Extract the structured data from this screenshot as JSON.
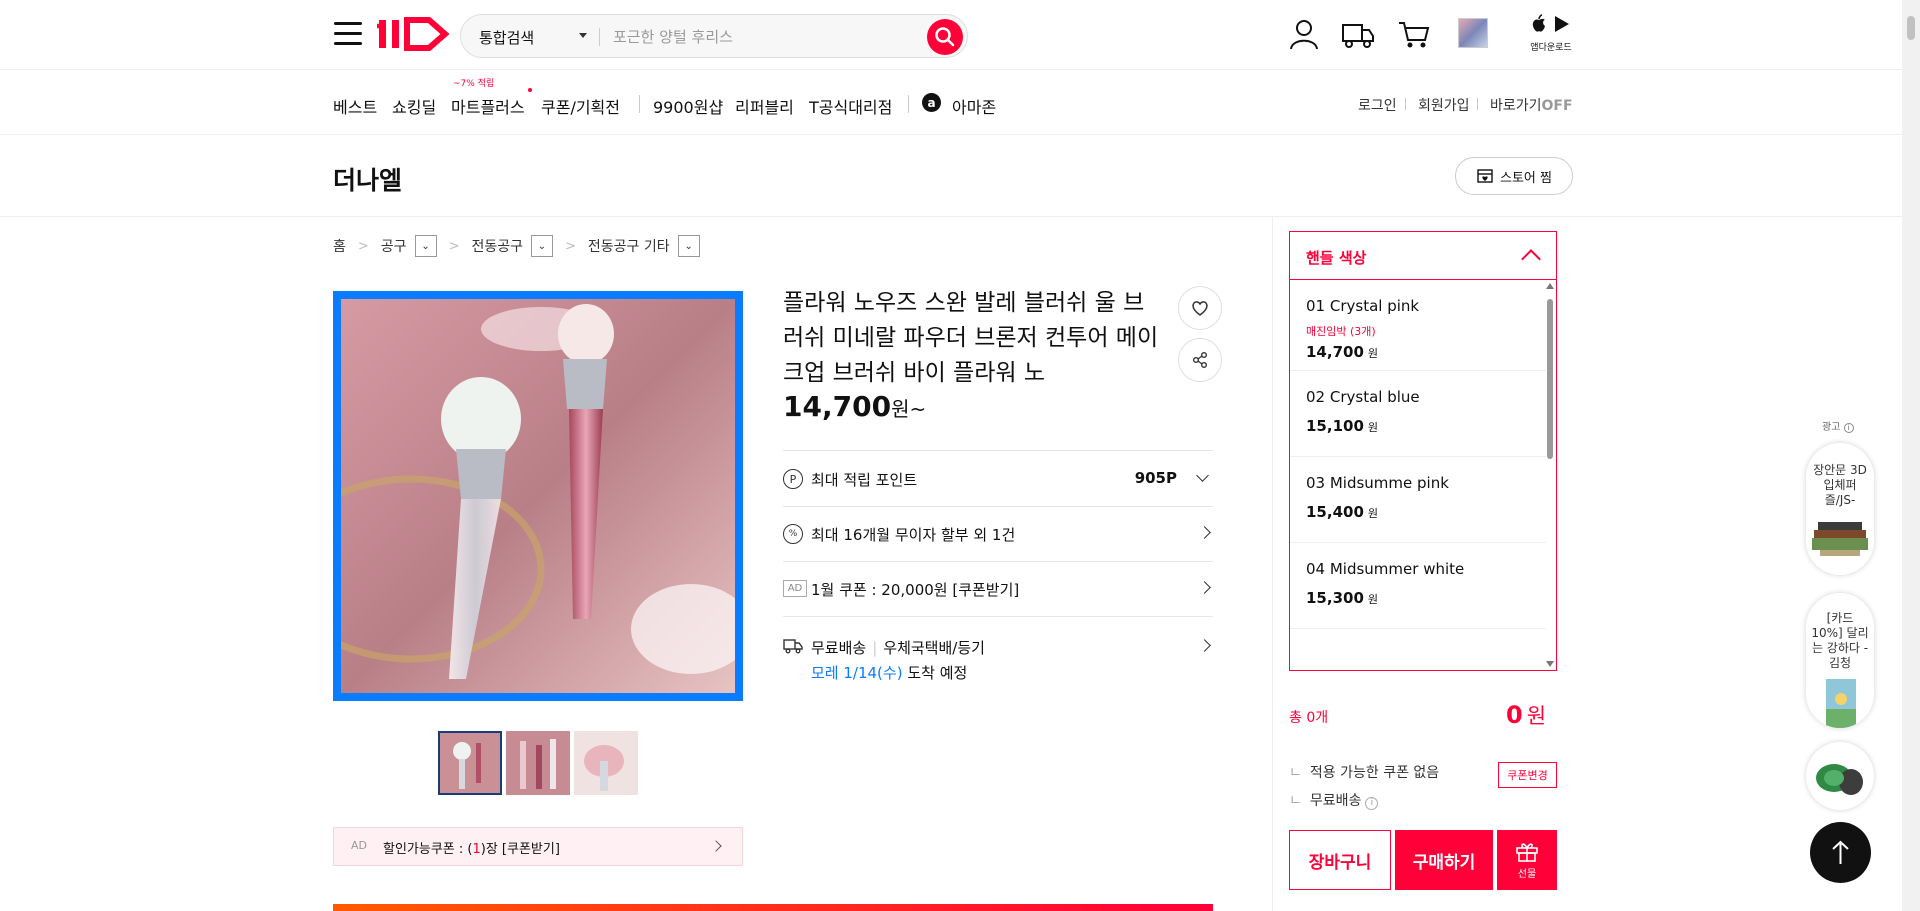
{
  "header": {
    "search_category": "통합검색",
    "search_placeholder": "포근한 양털 후리스",
    "app_download_label": "앱다운로드"
  },
  "nav": {
    "items": [
      "베스트",
      "쇼킹딜",
      "마트플러스",
      "쿠폰/기획전",
      "9900원샵",
      "리퍼블리",
      "T공식대리점",
      "아마존"
    ],
    "mart_badge": "~7% 적립",
    "right": [
      "로그인",
      "회원가입",
      "바로가기"
    ],
    "shortcut_state": "OFF"
  },
  "store": {
    "name": "더나엘",
    "zzim_label": "스토어 찜"
  },
  "breadcrumb": [
    "홈",
    "공구",
    "전동공구",
    "전동공구 기타"
  ],
  "product": {
    "title": "플라워 노우즈 스완 발레 블러쉬 울 브러쉬 미네랄 파우더 브론저 컨투어 메이크업 브러쉬 바이 플라워 노",
    "price": "14,700",
    "price_unit": "원~",
    "points_label": "최대 적립 포인트",
    "points_value": "905P",
    "installment_label": "최대 16개월 무이자 할부 외 1건",
    "ad_tag": "AD",
    "coupon_label": "1월 쿠폰 : 20,000원 [쿠폰받기]",
    "shipping_free": "무료배송",
    "shipping_method": "우체국택배/등기",
    "arrival_date": "모레 1/14(수)",
    "arrival_suffix": "도착 예정",
    "discount_coupon_prefix": "할인가능쿠폰 : (",
    "discount_coupon_count": "1",
    "discount_coupon_suffix": ")장 [쿠폰받기]"
  },
  "options": {
    "title": "핸들 색상",
    "items": [
      {
        "name": "01 Crystal pink",
        "warn": "매진임박 (3개)",
        "price": "14,700",
        "unit": "원"
      },
      {
        "name": "02 Crystal blue",
        "warn": "",
        "price": "15,100",
        "unit": "원"
      },
      {
        "name": "03 Midsumme pink",
        "warn": "",
        "price": "15,400",
        "unit": "원"
      },
      {
        "name": "04 Midsummer white",
        "warn": "",
        "price": "15,300",
        "unit": "원"
      }
    ]
  },
  "order": {
    "total_label": "총 0개",
    "total_amount": "0",
    "total_unit": "원",
    "no_coupon": "적용 가능한 쿠폰 없음",
    "coupon_change": "쿠폰변경",
    "free_shipping": "무료배송",
    "cart_label": "장바구니",
    "buy_label": "구매하기",
    "gift_label": "선물"
  },
  "ads": {
    "label": "광고",
    "cards": [
      "장안문 3D 입체퍼즐/JS-",
      "[카드10%] 달리는 강하다 - 김청"
    ]
  },
  "colors": {
    "brand": "#ff0038",
    "selected_border": "#0a7cff"
  }
}
